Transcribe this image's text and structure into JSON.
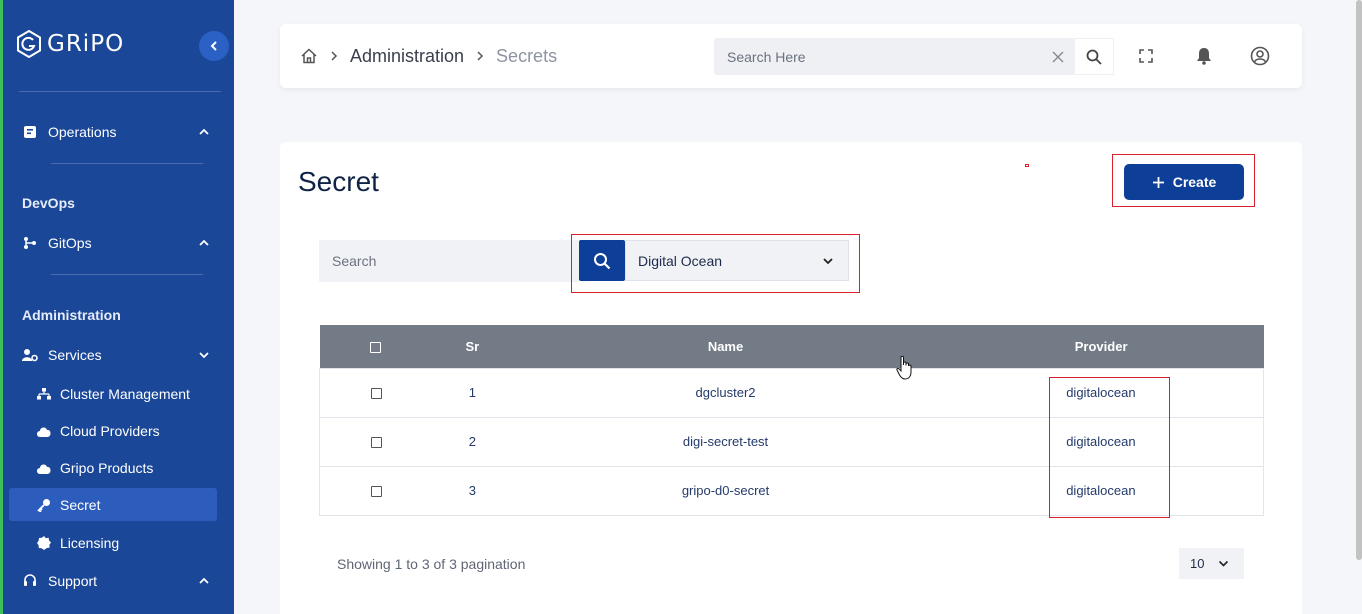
{
  "app": {
    "name": "GRiPO"
  },
  "sidebar": {
    "operations": "Operations",
    "devops_heading": "DevOps",
    "gitops": "GitOps",
    "administration_heading": "Administration",
    "services": "Services",
    "sub_items": [
      "Cluster Management",
      "Cloud Providers",
      "Gripo Products",
      "Secret",
      "Licensing"
    ],
    "support": "Support"
  },
  "topbar": {
    "breadcrumb": {
      "section": "Administration",
      "current": "Secrets"
    },
    "search_placeholder": "Search Here"
  },
  "page": {
    "title": "Secret",
    "create_label": "Create",
    "search_placeholder": "Search",
    "provider_filter": "Digital Ocean"
  },
  "table": {
    "columns": [
      "Sr",
      "Name",
      "Provider"
    ],
    "rows": [
      {
        "sr": "1",
        "name": "dgcluster2",
        "provider": "digitalocean"
      },
      {
        "sr": "2",
        "name": "digi-secret-test",
        "provider": "digitalocean"
      },
      {
        "sr": "3",
        "name": "gripo-d0-secret",
        "provider": "digitalocean"
      }
    ]
  },
  "footer": {
    "showing": "Showing 1 to 3 of 3 pagination",
    "per_page": "10"
  },
  "colors": {
    "sidebar": "#1a4797",
    "primary": "#0d3f98",
    "table_header": "#727b86",
    "highlight": "#d8202f"
  }
}
